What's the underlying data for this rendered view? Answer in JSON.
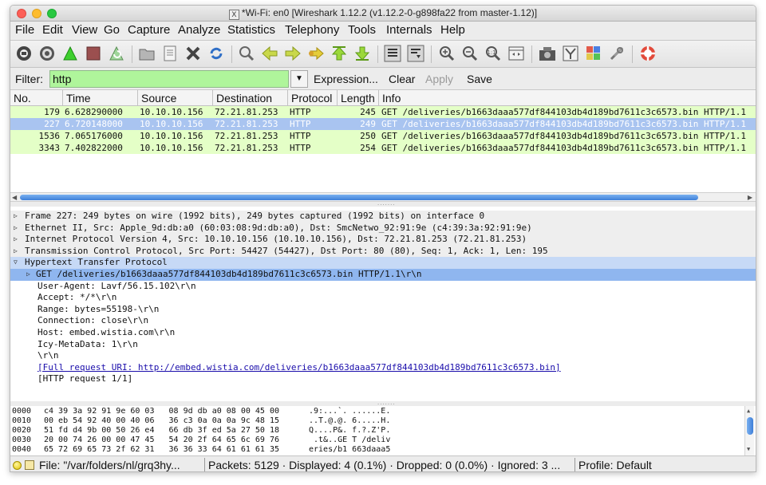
{
  "window": {
    "title": "*Wi-Fi: en0  [Wireshark 1.12.2  (v1.12.2-0-g898fa22 from master-1.12)]",
    "app_icon_glyph": "X"
  },
  "menu": [
    "File",
    "Edit",
    "View",
    "Go",
    "Capture",
    "Analyze",
    "Statistics",
    "Telephony",
    "Tools",
    "Internals",
    "Help"
  ],
  "toolbar_icons": [
    "interface-list-icon",
    "capture-options-icon",
    "start-capture-icon",
    "stop-capture-icon",
    "restart-capture-icon",
    "open-file-icon",
    "save-file-icon",
    "close-file-icon",
    "reload-icon",
    "find-packet-icon",
    "go-back-icon",
    "go-forward-icon",
    "go-to-packet-icon",
    "go-first-icon",
    "go-last-icon",
    "colorize-icon",
    "auto-scroll-icon",
    "zoom-in-icon",
    "zoom-out-icon",
    "normal-size-icon",
    "resize-columns-icon",
    "capture-filters-icon",
    "display-filters-icon",
    "coloring-rules-icon",
    "preferences-icon",
    "help-icon"
  ],
  "filter": {
    "label": "Filter:",
    "value": "http",
    "expression_label": "Expression...",
    "clear_label": "Clear",
    "apply_label": "Apply",
    "save_label": "Save",
    "valid_color": "#aff59b"
  },
  "packet_list": {
    "columns": [
      "No.",
      "Time",
      "Source",
      "Destination",
      "Protocol",
      "Length",
      "Info"
    ],
    "rows": [
      {
        "no": "179",
        "time": "6.628290000",
        "source": "10.10.10.156",
        "destination": "72.21.81.253",
        "protocol": "HTTP",
        "length": "245",
        "info": "GET /deliveries/b1663daaa577df844103db4d189bd7611c3c6573.bin HTTP/1.1",
        "selected": false
      },
      {
        "no": "227",
        "time": "6.720148000",
        "source": "10.10.10.156",
        "destination": "72.21.81.253",
        "protocol": "HTTP",
        "length": "249",
        "info": "GET /deliveries/b1663daaa577df844103db4d189bd7611c3c6573.bin HTTP/1.1",
        "selected": true
      },
      {
        "no": "1536",
        "time": "7.065176000",
        "source": "10.10.10.156",
        "destination": "72.21.81.253",
        "protocol": "HTTP",
        "length": "250",
        "info": "GET /deliveries/b1663daaa577df844103db4d189bd7611c3c6573.bin HTTP/1.1",
        "selected": false
      },
      {
        "no": "3343",
        "time": "7.402822000",
        "source": "10.10.10.156",
        "destination": "72.21.81.253",
        "protocol": "HTTP",
        "length": "254",
        "info": "GET /deliveries/b1663daaa577df844103db4d189bd7611c3c6573.bin HTTP/1.1",
        "selected": false
      }
    ],
    "row_color": "#e4ffc7",
    "selected_color": "#a9c4f0"
  },
  "details": [
    {
      "text": "Frame 227: 249 bytes on wire (1992 bits), 249 bytes captured (1992 bits) on interface 0",
      "level": 0,
      "tri": "▷",
      "style": "gray"
    },
    {
      "text": "Ethernet II, Src: Apple_9d:db:a0 (60:03:08:9d:db:a0), Dst: SmcNetwo_92:91:9e (c4:39:3a:92:91:9e)",
      "level": 0,
      "tri": "▷",
      "style": "gray"
    },
    {
      "text": "Internet Protocol Version 4, Src: 10.10.10.156 (10.10.10.156), Dst: 72.21.81.253 (72.21.81.253)",
      "level": 0,
      "tri": "▷",
      "style": "gray"
    },
    {
      "text": "Transmission Control Protocol, Src Port: 54427 (54427), Dst Port: 80 (80), Seq: 1, Ack: 1, Len: 195",
      "level": 0,
      "tri": "▷",
      "style": "gray"
    },
    {
      "text": "Hypertext Transfer Protocol",
      "level": 0,
      "tri": "▽",
      "style": "bluehdr"
    },
    {
      "text": "GET /deliveries/b1663daaa577df844103db4d189bd7611c3c6573.bin HTTP/1.1\\r\\n",
      "level": 1,
      "tri": "▷",
      "style": "sel"
    },
    {
      "text": "User-Agent: Lavf/56.15.102\\r\\n",
      "level": 1,
      "tri": "",
      "style": ""
    },
    {
      "text": "Accept: */*\\r\\n",
      "level": 1,
      "tri": "",
      "style": ""
    },
    {
      "text": "Range: bytes=55198-\\r\\n",
      "level": 1,
      "tri": "",
      "style": ""
    },
    {
      "text": "Connection: close\\r\\n",
      "level": 1,
      "tri": "",
      "style": ""
    },
    {
      "text": "Host: embed.wistia.com\\r\\n",
      "level": 1,
      "tri": "",
      "style": ""
    },
    {
      "text": "Icy-MetaData: 1\\r\\n",
      "level": 1,
      "tri": "",
      "style": ""
    },
    {
      "text": "\\r\\n",
      "level": 1,
      "tri": "",
      "style": ""
    },
    {
      "text": "[Full request URI: http://embed.wistia.com/deliveries/b1663daaa577df844103db4d189bd7611c3c6573.bin]",
      "level": 1,
      "tri": "",
      "style": "link"
    },
    {
      "text": "[HTTP request 1/1]",
      "level": 1,
      "tri": "",
      "style": ""
    }
  ],
  "hex_dump": [
    {
      "offset": "0000",
      "hex": "c4 39 3a 92 91 9e 60 03   08 9d db a0 08 00 45 00",
      "ascii": ".9:...`. ......E."
    },
    {
      "offset": "0010",
      "hex": "00 eb 54 92 40 00 40 06   36 c3 0a 0a 0a 9c 48 15",
      "ascii": "..T.@.@. 6.....H."
    },
    {
      "offset": "0020",
      "hex": "51 fd d4 9b 00 50 26 e4   66 db 3f ed 5a 27 50 18",
      "ascii": "Q....P&. f.?.Z'P."
    },
    {
      "offset": "0030",
      "hex": "20 00 74 26 00 00 47 45   54 20 2f 64 65 6c 69 76",
      "ascii": " .t&..GE T /deliv"
    },
    {
      "offset": "0040",
      "hex": "65 72 69 65 73 2f 62 31   36 36 33 64 61 61 61 35",
      "ascii": "eries/b1 663daaa5"
    }
  ],
  "status": {
    "file": "File: \"/var/folders/nl/grq3hy...",
    "packets": "Packets: 5129 · Displayed: 4 (0.1%) · Dropped: 0 (0.0%) · Ignored: 3 ...",
    "profile": "Profile: Default"
  }
}
